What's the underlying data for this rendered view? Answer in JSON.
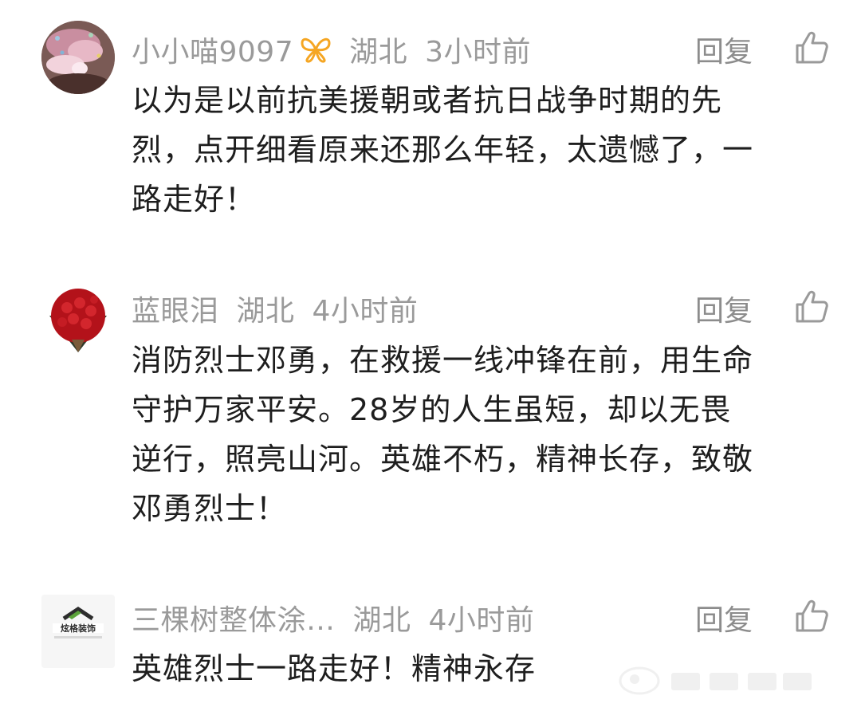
{
  "comments": [
    {
      "username": "小小喵9097",
      "location": "湖北",
      "time": "3小时前",
      "reply_label": "回复",
      "text": "以为是以前抗美援朝或者抗日战争时期的先烈，点开细看原来还那么年轻，太遗憾了，一路走好！",
      "lines": [
        "以为是以前抗美援朝或者抗日战争时期的先",
        "烈，点开细看原来还那么年轻，太遗憾了，一",
        "路走好！"
      ]
    },
    {
      "username": "蓝眼泪",
      "location": "湖北",
      "time": "4小时前",
      "reply_label": "回复",
      "lines": [
        "消防烈士邓勇，在救援一线冲锋在前，用生命",
        "守护万家平安。28岁的人生虽短，却以无畏",
        "逆行，照亮山河。英雄不朽，精神长存，致敬",
        "邓勇烈士！"
      ]
    },
    {
      "username": "三棵树整体涂…",
      "location": "湖北",
      "time": "4小时前",
      "reply_label": "回复",
      "lines": [
        "英雄烈士一路走好！精神永存"
      ],
      "avatar_logo_text": "炫格装饰"
    }
  ],
  "icons": {
    "badge": "butterfly-badge-icon",
    "like": "thumbs-up-icon"
  },
  "colors": {
    "meta_gray": "#9a9a9a",
    "text": "#1e1e1e",
    "badge_orange": "#f5a623"
  }
}
